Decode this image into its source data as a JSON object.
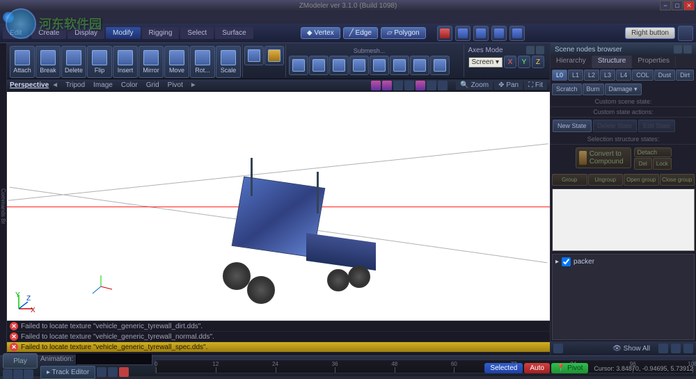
{
  "app": {
    "title": "ZModeler ver 3.1.0 (Build 1098)"
  },
  "menus": {
    "edit": "Edit",
    "left_tabs": [
      "Create",
      "Display",
      "Modify",
      "Rigging",
      "Select",
      "Surface"
    ]
  },
  "selection_modes": {
    "vertex": "Vertex",
    "edge": "Edge",
    "polygon": "Polygon"
  },
  "right_button": {
    "label": "Right button"
  },
  "tools": {
    "main": [
      {
        "label": "Attach"
      },
      {
        "label": "Break"
      },
      {
        "label": "Delete"
      },
      {
        "label": "Flip"
      },
      {
        "label": "Insert"
      },
      {
        "label": "Mirror"
      },
      {
        "label": "Move"
      },
      {
        "label": "Rot..."
      },
      {
        "label": "Scale"
      }
    ],
    "submesh_label": "Submesh..."
  },
  "axes": {
    "title": "Axes Mode",
    "selected": "Screen"
  },
  "viewport": {
    "mode": "Perspective",
    "items": [
      "Tripod",
      "Image",
      "Color",
      "Grid",
      "Pivot"
    ],
    "right": {
      "zoom": "Zoom",
      "pan": "Pan",
      "fit": "Fit"
    }
  },
  "console": {
    "lines": [
      "Failed to locate texture \"vehicle_generic_tyrewall_dirt.dds\".",
      "Failed to locate texture \"vehicle_generic_tyrewall_normal.dds\".",
      "Failed to locate texture \"vehicle_generic_tyrewall_spec.dds\"."
    ]
  },
  "right_panel": {
    "title": "Scene nodes browser",
    "tabs": [
      "Hierarchy",
      "Structure",
      "Properties"
    ],
    "active_tab": 1,
    "lods": [
      "L0",
      "L1",
      "L2",
      "L3",
      "L4",
      "COL",
      "Dust",
      "Dirt"
    ],
    "lod_active": 0,
    "damage": [
      "Scratch",
      "Burn",
      "Damage"
    ],
    "sections": {
      "custom_state": "Custom scene state:",
      "custom_actions": "Custom state actions:",
      "sel_states": "Selection structure states:"
    },
    "state_btns": {
      "new": "New State",
      "delete": "Delete State",
      "edit": "Edit State"
    },
    "compound": {
      "convert": "Convert to Compound",
      "detach": "Detach",
      "del": "Del",
      "lock": "Lock"
    },
    "group": [
      "Group",
      "Ungroup",
      "Open group",
      "Close group"
    ],
    "tree": {
      "root": "packer"
    },
    "show_all": "Show All"
  },
  "bottombar": {
    "play": "Play",
    "anim_label": "Animation:",
    "track_editor": "Track Editor",
    "ruler": [
      0,
      12,
      24,
      36,
      48,
      60,
      72,
      84,
      96,
      108
    ]
  },
  "status": {
    "selected": "Selected",
    "auto": "Auto",
    "pivot": "Pivot",
    "cursor": "Cursor: 3.84870, -0.94695, 5.73912"
  },
  "watermark": "河东软件园"
}
